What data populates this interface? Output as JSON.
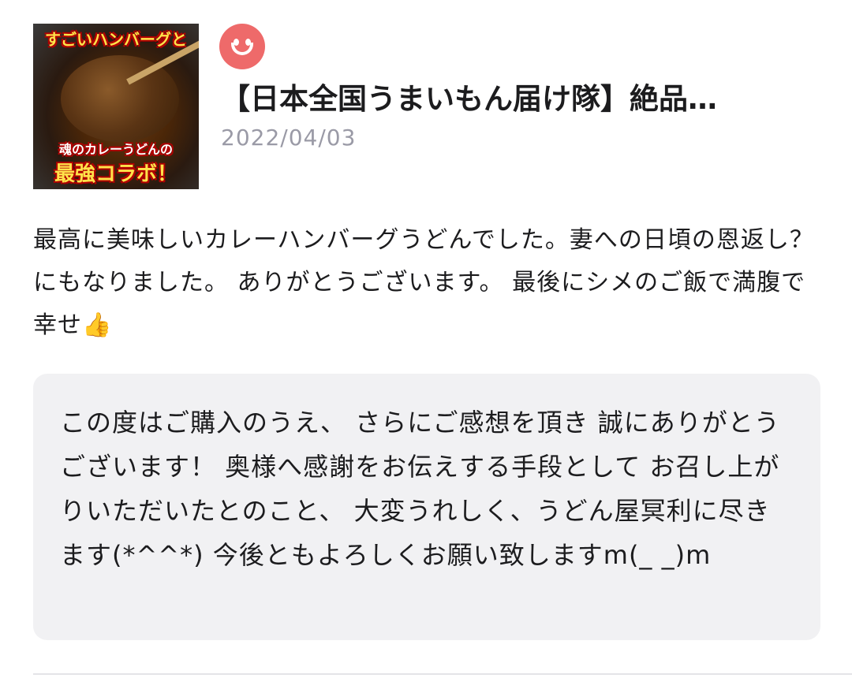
{
  "product": {
    "thumbnail_captions": [
      "すごいハンバーグと",
      "魂のカレーうどんの",
      "最強コラボ！"
    ],
    "title": "【日本全国うまいもん届け隊】絶品…",
    "date": "2022/04/03"
  },
  "reviewer": {
    "avatar_icon": "smiley-face-icon",
    "avatar_color": "#ee6a6a"
  },
  "review": {
    "text": "最高に美味しいカレーハンバーグうどんでした。妻への日頃の恩返し？にもなりました。 ありがとうございます。 最後にシメのご飯で満腹で幸せ👍"
  },
  "reply": {
    "text": "この度はご購入のうえ、 さらにご感想を頂き 誠にありがとうございます！ 奥様へ感謝をお伝えする手段として お召し上がりいただいたとのこと、 大変うれしく、うどん屋冥利に尽きます(*^^*) 今後ともよろしくお願い致しますm(_ _)m"
  }
}
